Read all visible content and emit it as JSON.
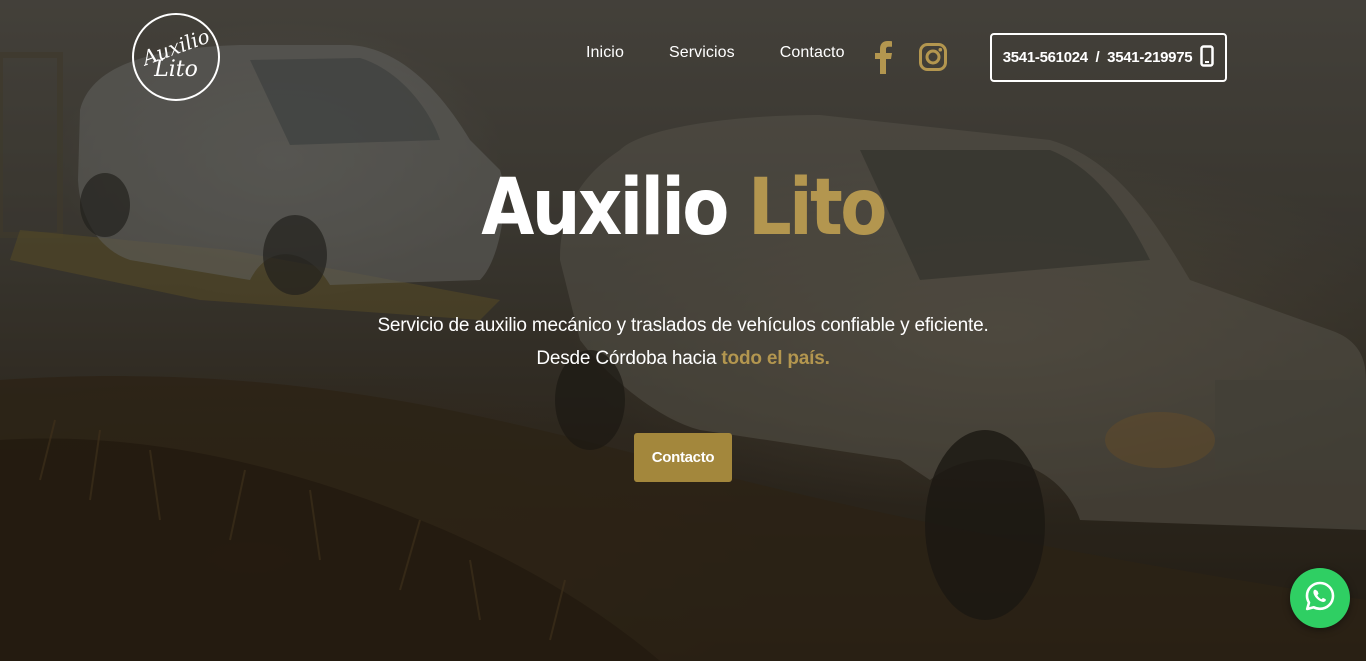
{
  "logo": {
    "line1": "Auxilio",
    "line2": "Lito"
  },
  "nav": {
    "items": [
      {
        "label": "Inicio"
      },
      {
        "label": "Servicios"
      },
      {
        "label": "Contacto"
      }
    ]
  },
  "social": {
    "icons": [
      "facebook-icon",
      "instagram-icon"
    ],
    "color": "#b3964f"
  },
  "header": {
    "phones": "3541-561024  /  3541-219975",
    "phone_icon": "mobile-phone-icon"
  },
  "hero": {
    "title_main": "Auxilio",
    "title_accent": "Lito",
    "subtitle_line1": "Servicio de auxilio mecánico y traslados de vehículos confiable y eficiente.",
    "subtitle_line2_prefix": "Desde Córdoba hacia ",
    "subtitle_line2_accent": "todo el país.",
    "cta_label": "Contacto"
  },
  "floating": {
    "whatsapp_icon": "whatsapp-icon",
    "color": "#2fcf63"
  },
  "colors": {
    "accent": "#b3964f",
    "button": "#a3873c"
  }
}
